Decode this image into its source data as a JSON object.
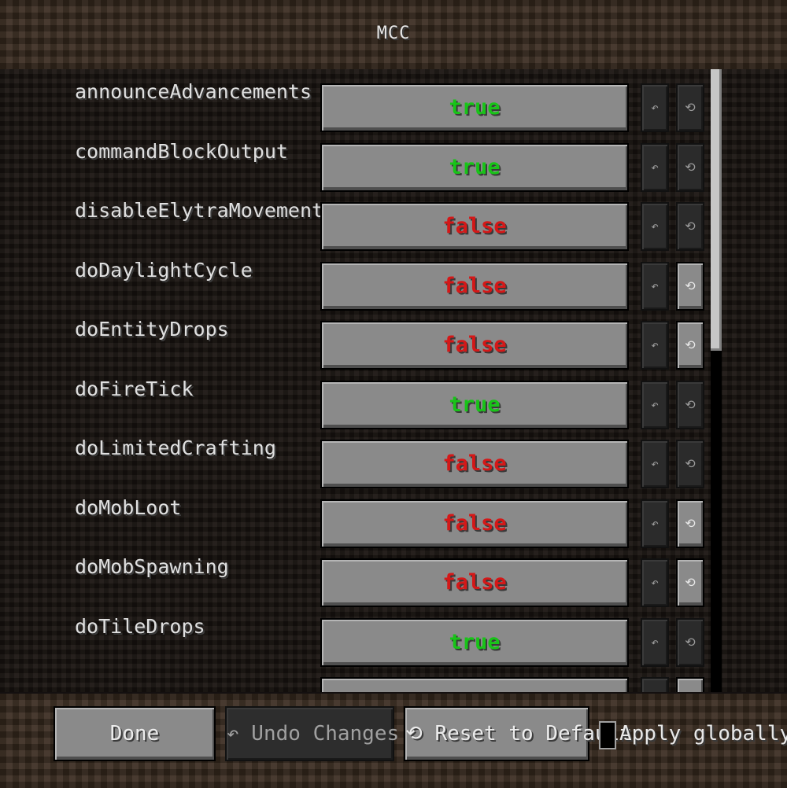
{
  "title": "MCC",
  "icons": {
    "undo": "↶",
    "reset": "⟲"
  },
  "rules": [
    {
      "name": "announceAdvancements",
      "value": "true",
      "reset_enabled": false
    },
    {
      "name": "commandBlockOutput",
      "value": "true",
      "reset_enabled": false
    },
    {
      "name": "disableElytraMovementCheck",
      "value": "false",
      "reset_enabled": false
    },
    {
      "name": "doDaylightCycle",
      "value": "false",
      "reset_enabled": true
    },
    {
      "name": "doEntityDrops",
      "value": "false",
      "reset_enabled": true
    },
    {
      "name": "doFireTick",
      "value": "true",
      "reset_enabled": false
    },
    {
      "name": "doLimitedCrafting",
      "value": "false",
      "reset_enabled": false
    },
    {
      "name": "doMobLoot",
      "value": "false",
      "reset_enabled": true
    },
    {
      "name": "doMobSpawning",
      "value": "false",
      "reset_enabled": true
    },
    {
      "name": "doTileDrops",
      "value": "true",
      "reset_enabled": false
    }
  ],
  "footer": {
    "done_label": "Done",
    "undo_label": "↶ Undo Changes",
    "reset_label": "⟲ Reset to Default",
    "apply_label": "Apply globally"
  },
  "colors": {
    "true": "#18c418",
    "false": "#d41818"
  }
}
